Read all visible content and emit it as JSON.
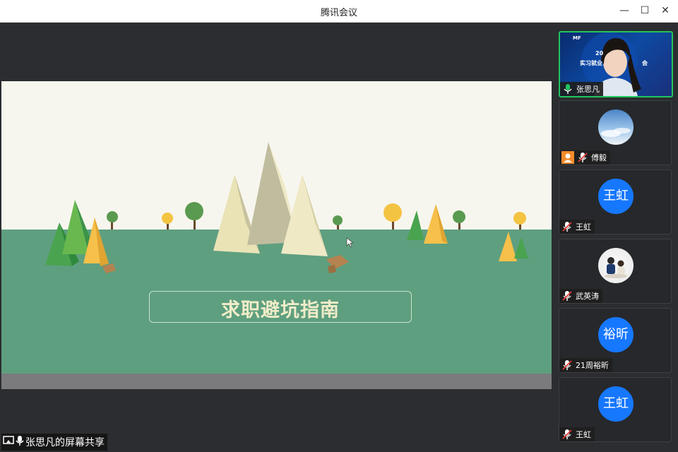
{
  "window": {
    "title": "腾讯会议",
    "minimize_glyph": "—",
    "maximize_glyph": "☐",
    "close_glyph": "✕"
  },
  "share": {
    "label": "张思凡的屏幕共享",
    "slide_title": "求职避坑指南"
  },
  "video_banner": {
    "line1": "MF",
    "line2": "20",
    "line3": "实习就业",
    "line4": "会"
  },
  "participants": [
    {
      "name": "张思凡",
      "avatar_text": "",
      "avatar_type": "video",
      "mic": "on"
    },
    {
      "name": "傅毅",
      "avatar_text": "",
      "avatar_type": "photo-sky",
      "mic": "muted",
      "badge": "person-icon"
    },
    {
      "name": "王虹",
      "avatar_text": "王虹",
      "avatar_type": "initials",
      "mic": "muted"
    },
    {
      "name": "武英涛",
      "avatar_text": "",
      "avatar_type": "photo-people",
      "mic": "muted"
    },
    {
      "name": "21周裕昕",
      "avatar_text": "裕昕",
      "avatar_type": "initials",
      "mic": "muted"
    },
    {
      "name": "王虹",
      "avatar_text": "王虹",
      "avatar_type": "initials",
      "mic": "muted"
    }
  ],
  "colors": {
    "accent": "#1677ff",
    "active_speaker": "#22c55e",
    "mic_on": "#22c55e",
    "slide_ground": "#5e9f7f"
  }
}
